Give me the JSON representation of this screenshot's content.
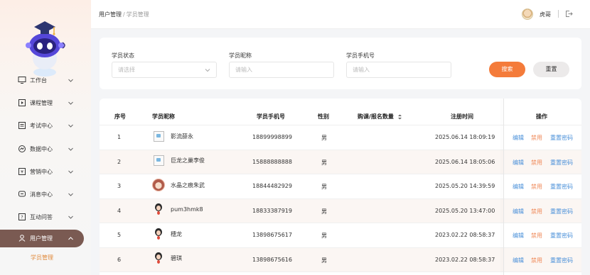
{
  "sidebar": {
    "items": [
      {
        "label": "工作台",
        "icon": "monitor-icon"
      },
      {
        "label": "课程管理",
        "icon": "book-icon"
      },
      {
        "label": "考试中心",
        "icon": "exam-icon"
      },
      {
        "label": "数据中心",
        "icon": "chart-icon"
      },
      {
        "label": "营销中心",
        "icon": "marketing-icon"
      },
      {
        "label": "消息中心",
        "icon": "message-icon"
      },
      {
        "label": "互动问答",
        "icon": "qa-icon"
      },
      {
        "label": "用户管理",
        "icon": "user-icon"
      }
    ],
    "active_item": "用户管理",
    "sub_item": "学员管理",
    "colors": {
      "active_bg": "#7a5a52",
      "sub_active": "#e08a3c"
    }
  },
  "header": {
    "breadcrumb": [
      "用户管理",
      "学员管理"
    ],
    "breadcrumb_sep": "/",
    "user_name": "虎哥"
  },
  "filters": {
    "status": {
      "label": "学员状态",
      "placeholder": "请选择"
    },
    "nickname": {
      "label": "学员昵称",
      "placeholder": "请输入"
    },
    "phone": {
      "label": "学员手机号",
      "placeholder": "请输入"
    },
    "search_button": "搜索",
    "reset_button": "重置"
  },
  "table": {
    "columns": [
      "序号",
      "学员昵称",
      "学员手机号",
      "性别",
      "购课/报名数量",
      "注册时间",
      "操作"
    ],
    "sort_icon": "sort-icon",
    "rows": [
      {
        "no": "1",
        "nickname": "影流薛永",
        "avatar": "broken-image",
        "phone": "18899998899",
        "gender": "男",
        "count": "",
        "registered": "2025.06.14 18:09:19"
      },
      {
        "no": "2",
        "nickname": "巨龙之巢李俊",
        "avatar": "broken-image",
        "phone": "15888888888",
        "gender": "男",
        "count": "",
        "registered": "2025.06.14 18:05:06"
      },
      {
        "no": "3",
        "nickname": "水晶之痕朱武",
        "avatar": "girl-avatar",
        "phone": "18844482929",
        "gender": "男",
        "count": "",
        "registered": "2025.05.20 14:39:59"
      },
      {
        "no": "4",
        "nickname": "pum3hmk8",
        "avatar": "person-avatar",
        "phone": "18833387919",
        "gender": "男",
        "count": "",
        "registered": "2025.05.20 13:47:00"
      },
      {
        "no": "5",
        "nickname": "穗龙",
        "avatar": "person-avatar",
        "phone": "13898675617",
        "gender": "男",
        "count": "",
        "registered": "2023.02.22 08:58:37"
      },
      {
        "no": "6",
        "nickname": "碧琪",
        "avatar": "person-avatar",
        "phone": "13898675616",
        "gender": "男",
        "count": "",
        "registered": "2023.02.22 08:58:37"
      }
    ],
    "actions": {
      "edit": "编辑",
      "disable": "禁用",
      "reset_password": "重置密码"
    }
  },
  "colors": {
    "primary": "#f47b3a",
    "link": "#4a90d9",
    "warn_link": "#ef8a5a"
  }
}
